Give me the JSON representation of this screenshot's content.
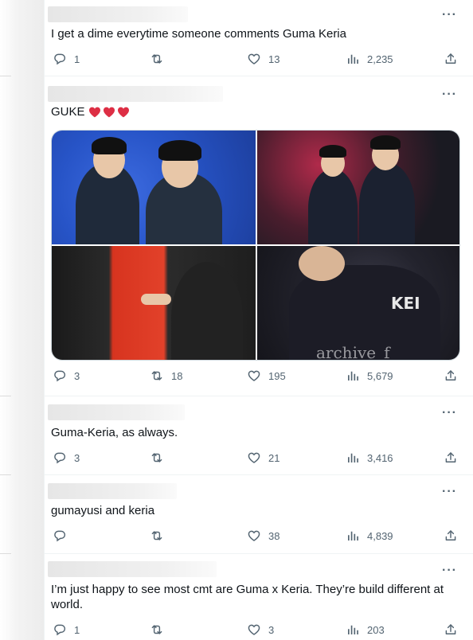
{
  "tweets": [
    {
      "text": "I get a dime everytime someone comments Guma Keria",
      "reply_count": "1",
      "retweet_count": "",
      "like_count": "13",
      "view_count": "2,235"
    },
    {
      "text": "GUKE",
      "emoji": [
        "red-heart",
        "red-heart",
        "red-heart"
      ],
      "reply_count": "3",
      "retweet_count": "18",
      "like_count": "195",
      "view_count": "5,679",
      "media": {
        "watermark": "archive_f",
        "jersey_name": "KEI"
      }
    },
    {
      "text": "Guma-Keria, as always.",
      "reply_count": "3",
      "retweet_count": "",
      "like_count": "21",
      "view_count": "3,416"
    },
    {
      "text": "gumayusi and keria",
      "reply_count": "",
      "retweet_count": "",
      "like_count": "38",
      "view_count": "4,839"
    },
    {
      "text": "I’m just happy to see most cmt are Guma x Keria. They’re build different at world.",
      "reply_count": "1",
      "retweet_count": "",
      "like_count": "3",
      "view_count": "203"
    }
  ],
  "icons": {
    "more": "more-icon",
    "reply": "reply-icon",
    "retweet": "retweet-icon",
    "like": "heart-icon",
    "views": "views-icon",
    "share": "share-icon"
  },
  "colors": {
    "text": "#0f1419",
    "muted": "#536471",
    "divider": "#eff3f4",
    "heart_emoji": "#dd2e44"
  }
}
